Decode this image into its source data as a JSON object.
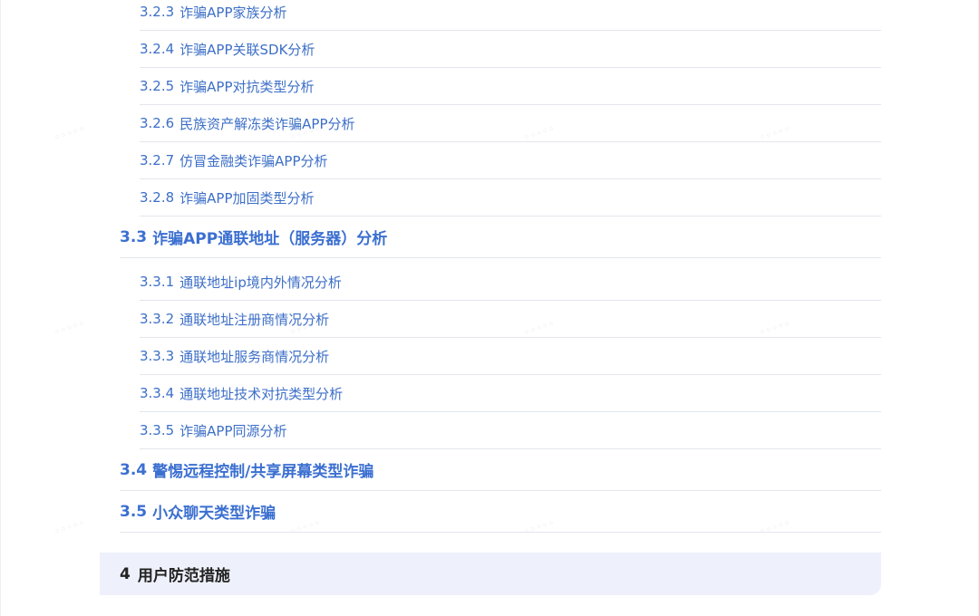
{
  "toc": {
    "items": [
      {
        "num": "3.2.3",
        "label": "诈骗APP家族分析"
      },
      {
        "num": "3.2.4",
        "label": "诈骗APP关联SDK分析"
      },
      {
        "num": "3.2.5",
        "label": "诈骗APP对抗类型分析"
      },
      {
        "num": "3.2.6",
        "label": "民族资产解冻类诈骗APP分析"
      },
      {
        "num": "3.2.7",
        "label": "仿冒金融类诈骗APP分析"
      },
      {
        "num": "3.2.8",
        "label": "诈骗APP加固类型分析"
      },
      {
        "num": "3.3",
        "label": "诈骗APP通联地址（服务器）分析"
      },
      {
        "num": "3.3.1",
        "label": "通联地址ip境内外情况分析"
      },
      {
        "num": "3.3.2",
        "label": "通联地址注册商情况分析"
      },
      {
        "num": "3.3.3",
        "label": "通联地址服务商情况分析"
      },
      {
        "num": "3.3.4",
        "label": "通联地址技术对抗类型分析"
      },
      {
        "num": "3.3.5",
        "label": "诈骗APP同源分析"
      },
      {
        "num": "3.4",
        "label": "警惕远程控制/共享屏幕类型诈骗"
      },
      {
        "num": "3.5",
        "label": "小众聊天类型诈骗"
      }
    ],
    "chapter": {
      "num": "4",
      "label": "用户防范措施"
    }
  },
  "colors": {
    "link": "#3d6fc7",
    "section": "#3b6fd0",
    "chapter_bg": "#eef1fb",
    "divider": "#e3e6ec"
  }
}
